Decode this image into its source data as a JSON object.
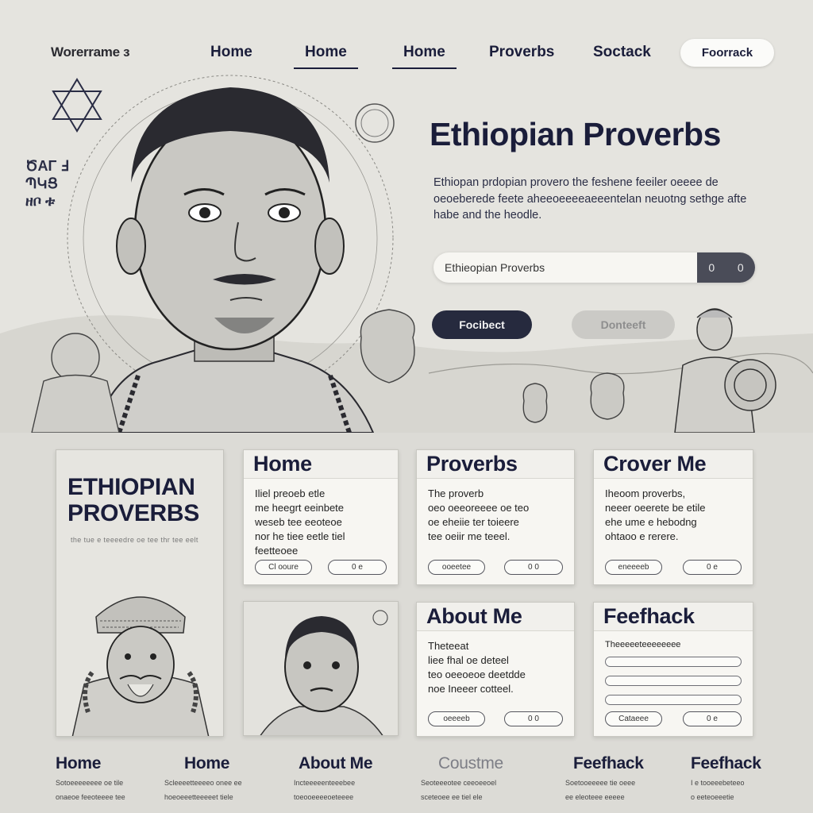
{
  "nav": {
    "brand": "Worerrame з",
    "links": [
      "Home",
      "Home",
      "Home",
      "Proverbs",
      "Soctack"
    ],
    "cta": "Foorrack"
  },
  "hero": {
    "side_text": "ԾΑΓ Ⅎ\nՊԿՑ\nዘቦ ቱ",
    "title": "Ethiopian Proverbs",
    "description": "Ethiopan prdopian provero the feshene feeiler oeeee de oeoeberede feete aheeoeeeeaeeentelan neuotng sethge afte habe and the heodle.",
    "search_value": "Ethieopian Proverbs",
    "search_icon_a": "0",
    "search_icon_b": "0",
    "primary_button": "Focibect",
    "secondary_button": "Donteeft"
  },
  "poster": {
    "title": "ETHIOPIAN PROVERBS",
    "subtitle": "the tue e teeeedre oe tee thr tee eelt"
  },
  "cards": [
    {
      "title": "Home",
      "body": "Iliel preoeb etle\nme heegrt eeinbete\nweseb tee eeoteoe\nnor he tiee eetle tiel\nfeetteoee",
      "left_pill": "Cl ooure",
      "right_pill": "0 e"
    },
    {
      "title": "Proverbs",
      "body": "The proverb\noeo oeeoreeee oe teo\noe eheiie ter toieere\ntee oeiir me teeel.",
      "left_pill": "ooeetee",
      "right_pill": "0 0"
    },
    {
      "title": "Crover Me",
      "body": "Iheoom proverbs,\nneeer oeerete be etile\nehe ume e hebodng\nohtaoo e rerere.",
      "left_pill": "eneeeeb",
      "right_pill": "0 e"
    },
    {
      "title": "About Me",
      "body": "Theteeat\nliee fhal oe deteel\nteo oeeoeoe deetdde\nnoe Ineeer cotteel.",
      "left_pill": "oeeeeb",
      "right_pill": "0 0"
    },
    {
      "title": "Feefhack",
      "body": "Theeeeeteeeeeeee",
      "left_pill": "Cataeee",
      "right_pill": "0 e"
    }
  ],
  "footer": [
    {
      "title": "Home",
      "lines": [
        "Sotoeeeeeeee oe tile",
        "onaeoe feeoteeee tee"
      ]
    },
    {
      "title": "Home",
      "lines": [
        "Scleeeetteeeeo onee ee",
        "hoeoeeetteeeeet tiele"
      ]
    },
    {
      "title": "About Me",
      "lines": [
        "Incteeeeenteeebee",
        "toeooeeeeoeteeee"
      ]
    },
    {
      "title": "Coustme",
      "lines": [
        "Seoteeeotee ceeoeeoel",
        "sceteoee ee tiel ele"
      ]
    },
    {
      "title": "Feefhack",
      "lines": [
        "Soetooeeeee tie oeee",
        "ee eleoteee eeeee"
      ]
    },
    {
      "title": "Feefhack",
      "lines": [
        "I e tooeeebeteeo",
        "o eeteoeeetie"
      ]
    }
  ],
  "colors": {
    "accent": "#1a1d3a",
    "primary_button": "#262a3e",
    "background": "#dcdbd6"
  }
}
